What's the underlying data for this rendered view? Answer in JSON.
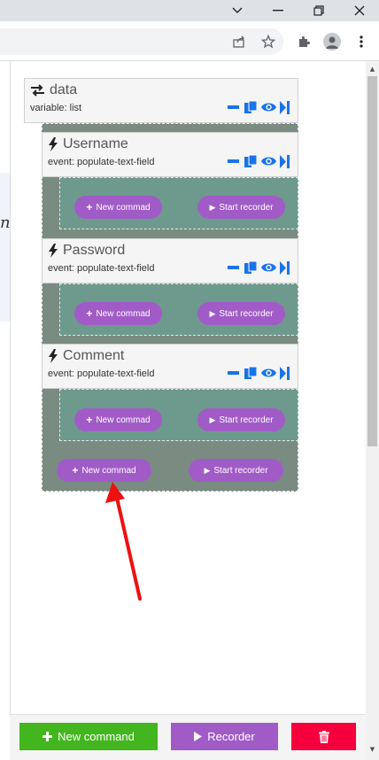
{
  "window": {
    "minimize_icon": "chevron-down-icon",
    "buttons": [
      "minimize",
      "restore",
      "close"
    ]
  },
  "toolbar": {
    "icons": [
      "share-icon",
      "star-icon",
      "puzzle-icon",
      "profile-icon",
      "menu-icon"
    ]
  },
  "left_page": {
    "visible_letter": "n"
  },
  "blocks": {
    "data": {
      "title": "data",
      "subtitle": "variable: list",
      "icon": "swap-arrows-icon"
    },
    "items": [
      {
        "title": "Username",
        "subtitle": "event: populate-text-field",
        "icon": "bolt-icon"
      },
      {
        "title": "Password",
        "subtitle": "event: populate-text-field",
        "icon": "bolt-icon"
      },
      {
        "title": "Comment",
        "subtitle": "event: populate-text-field",
        "icon": "bolt-icon"
      }
    ]
  },
  "buttons": {
    "new_commad": "New commad",
    "start_recorder": "Start recorder"
  },
  "bottom": {
    "new_command": "New command",
    "recorder": "Recorder",
    "colors": {
      "new_command": "#43b51e",
      "recorder": "#a15bc7",
      "delete": "#f5003d"
    }
  },
  "annotation": {
    "arrow_color": "#ee1111"
  }
}
